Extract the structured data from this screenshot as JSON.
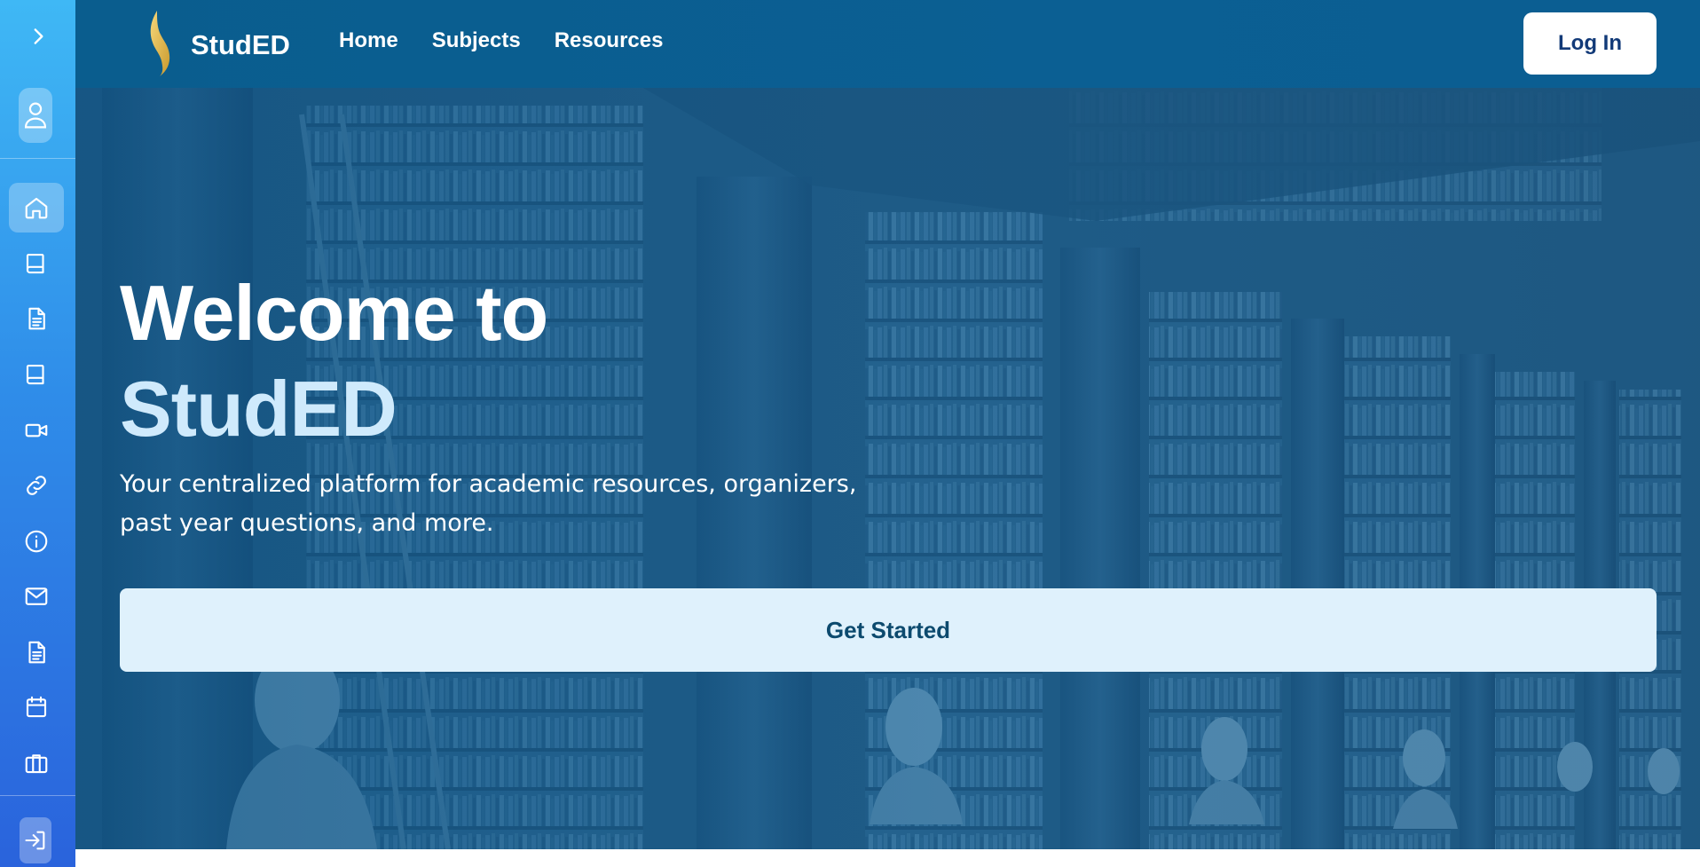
{
  "brand": {
    "name": "StudED"
  },
  "nav": {
    "links": [
      "Home",
      "Subjects",
      "Resources"
    ],
    "login_label": "Log In"
  },
  "hero": {
    "title_line1": "Welcome to",
    "title_line2": "StudED",
    "subtitle": "Your centralized platform for academic resources, organizers, past year questions, and more.",
    "cta_label": "Get Started"
  },
  "sidebar": {
    "toggle_icon": "chevron-right-icon",
    "avatar_icon": "user-icon",
    "active_index": 0,
    "items": [
      {
        "icon": "home-icon"
      },
      {
        "icon": "book-icon"
      },
      {
        "icon": "document-icon"
      },
      {
        "icon": "book-icon"
      },
      {
        "icon": "video-icon"
      },
      {
        "icon": "link-icon"
      },
      {
        "icon": "info-icon"
      },
      {
        "icon": "mail-icon"
      },
      {
        "icon": "document-icon"
      },
      {
        "icon": "calendar-icon"
      },
      {
        "icon": "briefcase-icon"
      }
    ],
    "logout_icon": "login-arrow-icon"
  },
  "colors": {
    "rail_top": "#3fb8f5",
    "rail_bottom": "#2a63dc",
    "topnav": "#0b5f93",
    "login_text": "#123a78",
    "cta_bg": "#dff1fc",
    "cta_text": "#0c4a6e",
    "title_accent": "#cfeafc"
  }
}
